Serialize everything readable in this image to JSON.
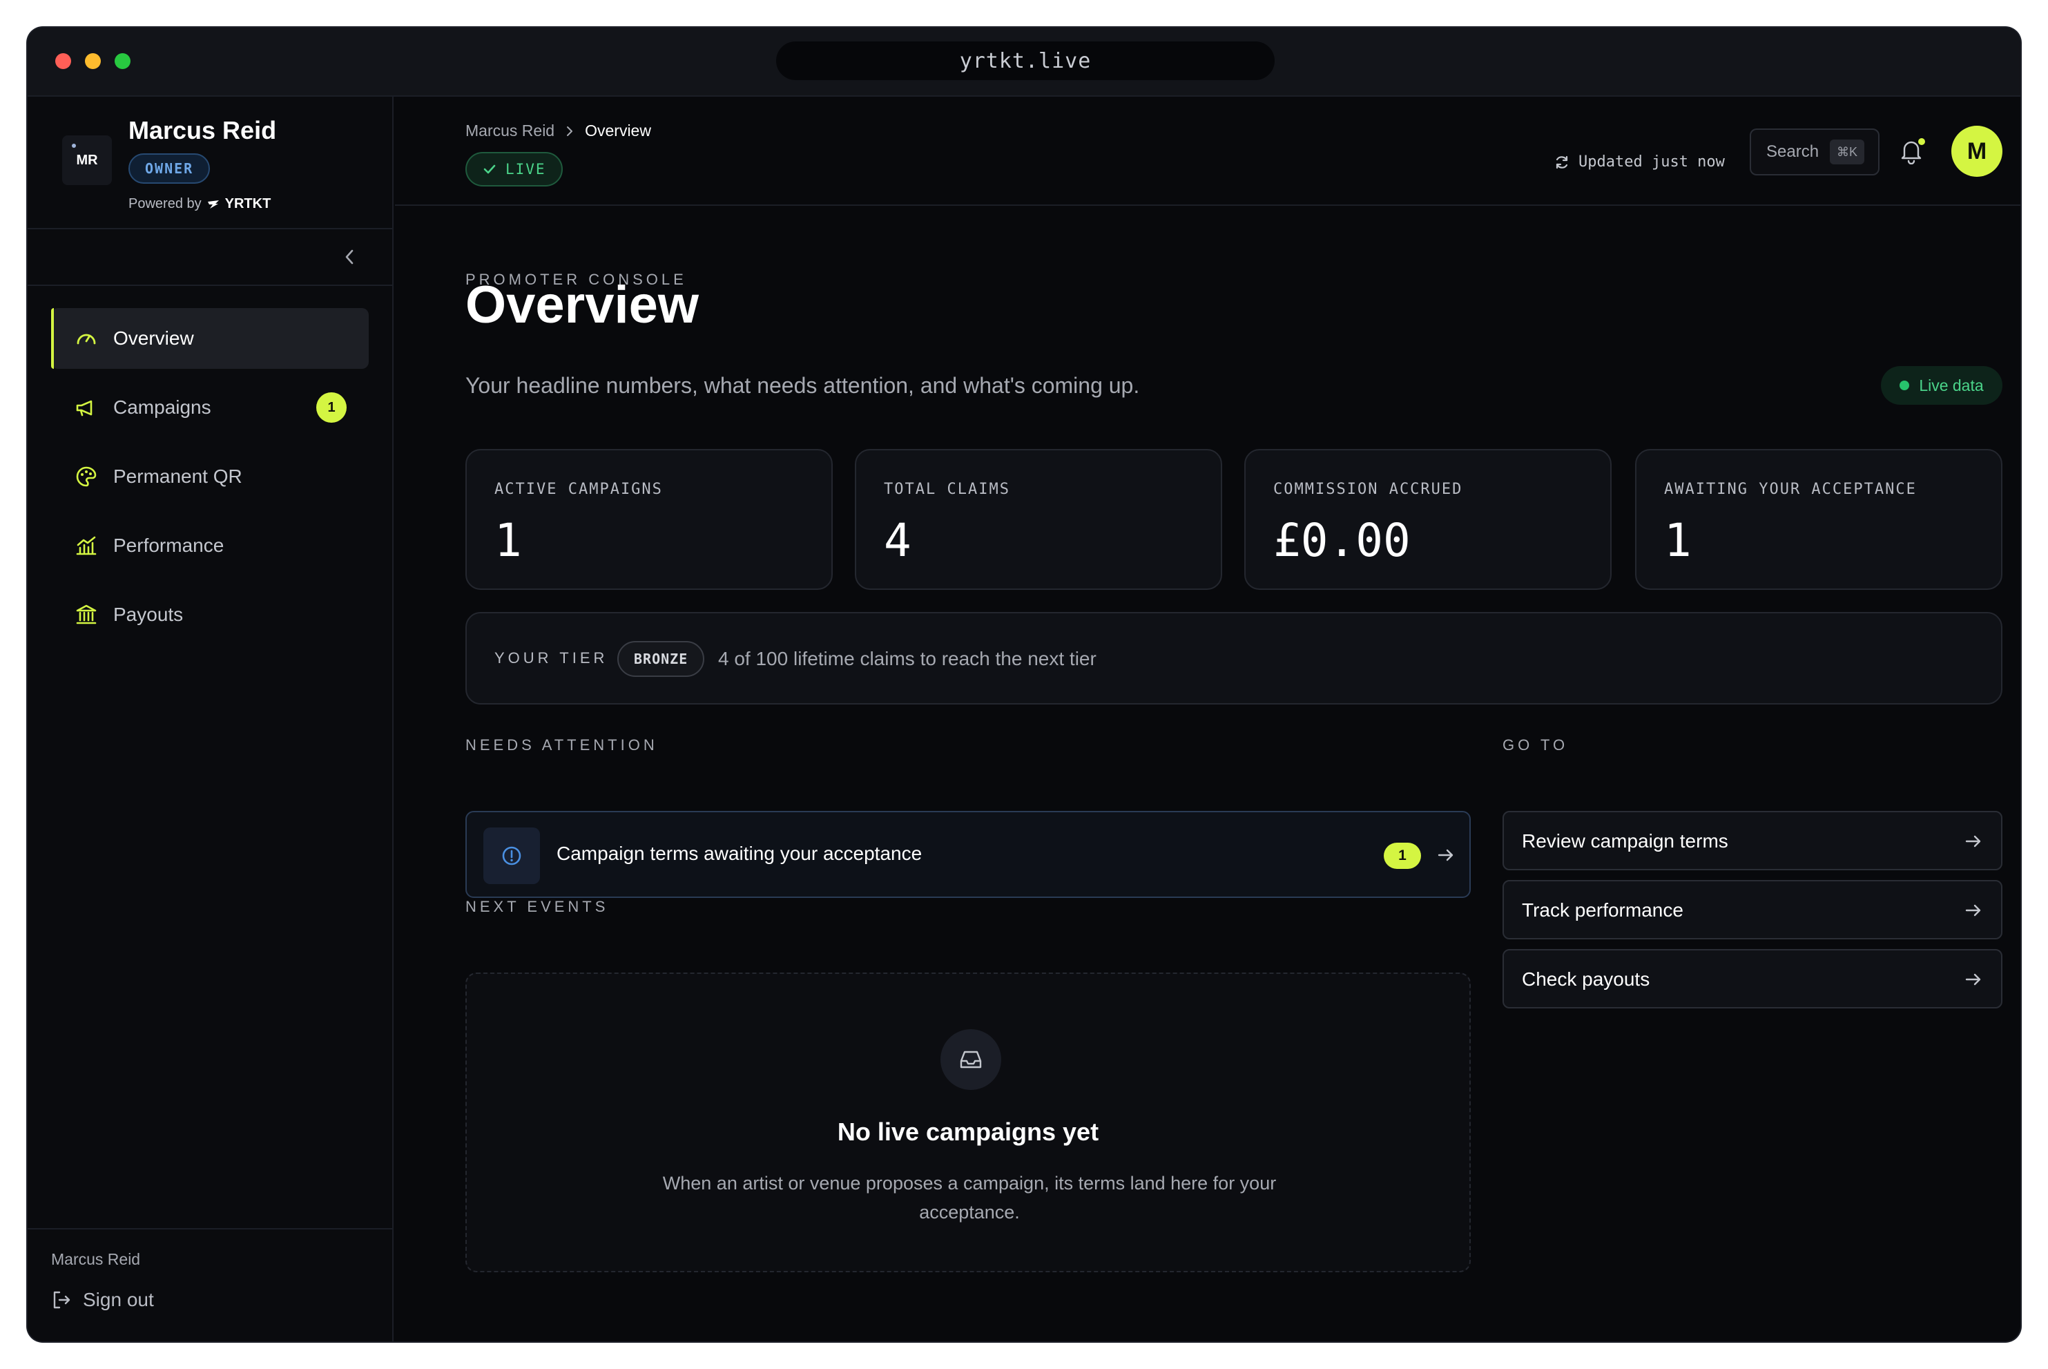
{
  "window": {
    "url": "yrtkt.live"
  },
  "sidebar": {
    "brand": {
      "logo_text": "MR",
      "name": "Marcus Reid",
      "role_badge": "OWNER",
      "powered_by_label": "Powered by",
      "powered_by_name": "YRTKT"
    },
    "items": [
      {
        "label": "Overview",
        "icon": "gauge-icon",
        "active": true
      },
      {
        "label": "Campaigns",
        "icon": "megaphone-icon",
        "count": "1"
      },
      {
        "label": "Permanent QR",
        "icon": "palette-icon"
      },
      {
        "label": "Performance",
        "icon": "bar-chart-icon"
      },
      {
        "label": "Payouts",
        "icon": "bank-icon"
      }
    ],
    "footer": {
      "user": "Marcus Reid",
      "sign_out": "Sign out"
    }
  },
  "header": {
    "breadcrumb": [
      "Marcus Reid",
      "Overview"
    ],
    "status": "LIVE",
    "updated": "Updated just now",
    "search_label": "Search",
    "search_shortcut": "⌘K",
    "avatar_initial": "M"
  },
  "page": {
    "eyebrow": "PROMOTER CONSOLE",
    "title": "Overview",
    "subtitle": "Your headline numbers, what needs attention, and what's coming up.",
    "live_badge": "Live data"
  },
  "stats": [
    {
      "label": "ACTIVE CAMPAIGNS",
      "value": "1"
    },
    {
      "label": "TOTAL CLAIMS",
      "value": "4"
    },
    {
      "label": "COMMISSION ACCRUED",
      "value": "£0.00"
    },
    {
      "label": "AWAITING YOUR ACCEPTANCE",
      "value": "1"
    }
  ],
  "tier": {
    "label": "YOUR TIER",
    "badge": "BRONZE",
    "progress_text": "4 of 100 lifetime claims to reach the next tier"
  },
  "needs_attention": {
    "heading": "NEEDS ATTENTION",
    "item": {
      "label": "Campaign terms awaiting your acceptance",
      "count": "1"
    }
  },
  "next_events": {
    "heading": "NEXT EVENTS",
    "empty_title": "No live campaigns yet",
    "empty_desc": "When an artist or venue proposes a campaign, its terms land here for your acceptance."
  },
  "goto": {
    "heading": "GO TO",
    "links": [
      "Review campaign terms",
      "Track performance",
      "Check payouts"
    ]
  },
  "colors": {
    "accent": "#d4f542",
    "success": "#4bd48a",
    "info": "#6fa8e8",
    "background": "#08090c"
  }
}
